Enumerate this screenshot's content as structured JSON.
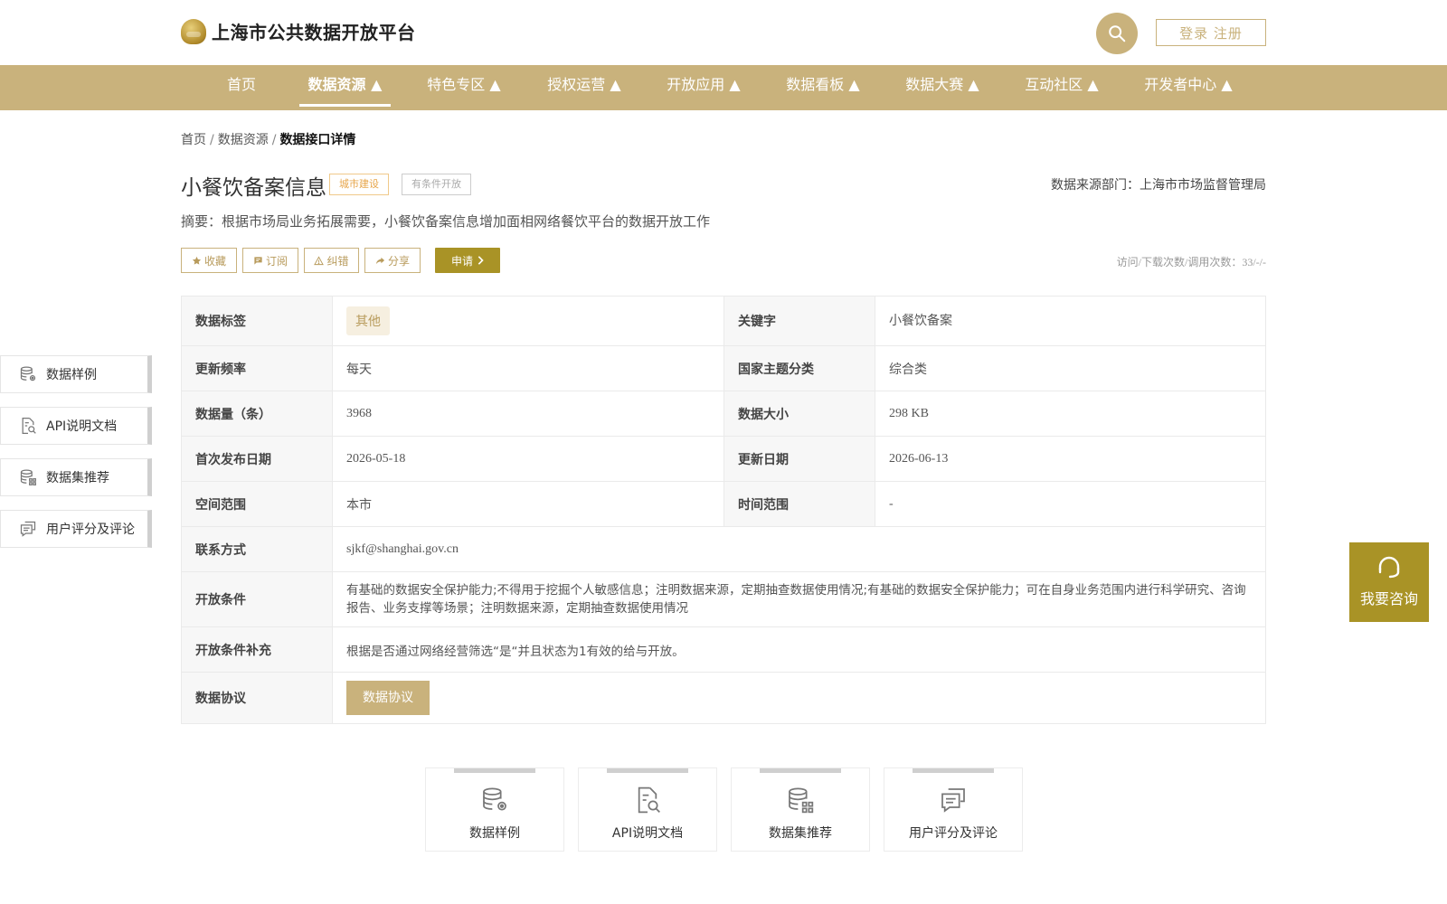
{
  "header": {
    "logo_text": "上海市公共数据开放平台",
    "login_label": "登录 注册"
  },
  "nav": {
    "items": [
      {
        "label": "首页"
      },
      {
        "label": "数据资源 ▲"
      },
      {
        "label": "特色专区 ▲"
      },
      {
        "label": "授权运营 ▲"
      },
      {
        "label": "开放应用 ▲"
      },
      {
        "label": "数据看板 ▲"
      },
      {
        "label": "数据大赛 ▲"
      },
      {
        "label": "互动社区 ▲"
      },
      {
        "label": "开发者中心 ▲"
      }
    ],
    "active_index": 1
  },
  "breadcrumb": {
    "home": "首页",
    "parent": "数据资源",
    "current": "数据接口详情",
    "separator": "/"
  },
  "dataset": {
    "title": "小餐饮备案信息",
    "tags": [
      "城市建设",
      "有条件开放"
    ],
    "source": "数据来源部门：上海市市场监督管理局",
    "summary": "摘要：根据市场局业务拓展需要，小餐饮备案信息增加面相网络餐饮平台的数据开放工作",
    "visits": "访问/下载次数/调用次数：33/-/-"
  },
  "actions": {
    "favorite": "收藏",
    "subscribe": "订阅",
    "report": "纠错",
    "share": "分享",
    "apply": "申请"
  },
  "info": {
    "tag_label": "数据标签",
    "tag_value": "其他",
    "keyword_label": "关键字",
    "keyword_value": "小餐饮备案",
    "freq_label": "更新频率",
    "freq_value": "每天",
    "theme_label": "国家主题分类",
    "theme_value": "综合类",
    "count_label": "数据量（条）",
    "count_value": "3968",
    "size_label": "数据大小",
    "size_value": "298 KB",
    "first_pub_label": "首次发布日期",
    "first_pub_value": "2026-05-18",
    "update_label": "更新日期",
    "update_value": "2026-06-13",
    "space_label": "空间范围",
    "space_value": "本市",
    "time_label": "时间范围",
    "time_value": "-",
    "contact_label": "联系方式",
    "contact_value": "sjkf@shanghai.gov.cn",
    "cond_label": "开放条件",
    "cond_value": "有基础的数据安全保护能力;不得用于挖掘个人敏感信息；注明数据来源，定期抽查数据使用情况;有基础的数据安全保护能力；可在自身业务范围内进行科学研究、咨询报告、业务支撑等场景；注明数据来源，定期抽查数据使用情况",
    "cond_extra_label": "开放条件补充",
    "cond_extra_value": "根据是否通过网络经营筛选“是“并且状态为1有效的给与开放。",
    "protocol_label": "数据协议",
    "protocol_button": "数据协议"
  },
  "side_menu": [
    {
      "label": "数据样例",
      "icon": "database-gear-icon"
    },
    {
      "label": "API说明文档",
      "icon": "document-search-icon"
    },
    {
      "label": "数据集推荐",
      "icon": "database-grid-icon"
    },
    {
      "label": "用户评分及评论",
      "icon": "comment-icon"
    }
  ],
  "consult": {
    "label": "我要咨询",
    "icon": "headset-icon"
  },
  "bottom_cards": [
    {
      "label": "数据样例",
      "icon": "database-gear-icon"
    },
    {
      "label": "API说明文档",
      "icon": "document-search-icon"
    },
    {
      "label": "数据集推荐",
      "icon": "database-grid-icon"
    },
    {
      "label": "用户评分及评论",
      "icon": "comment-icon"
    }
  ],
  "colors": {
    "brand": "#c9b27c",
    "accent_dark": "#a99326",
    "tag_orange": "#e7a54a"
  }
}
